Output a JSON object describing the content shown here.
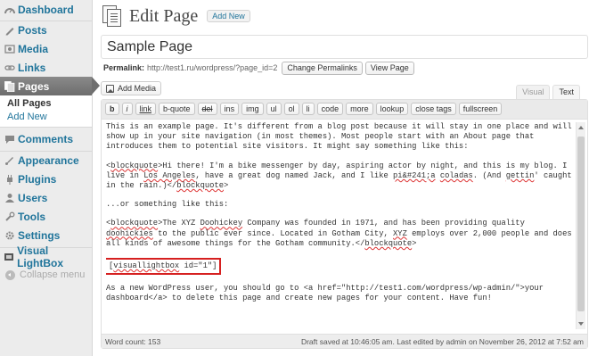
{
  "sidebar": {
    "items": [
      {
        "label": "Dashboard",
        "icon": "dashboard-icon"
      },
      {
        "label": "Posts",
        "icon": "posts-icon"
      },
      {
        "label": "Media",
        "icon": "media-icon"
      },
      {
        "label": "Links",
        "icon": "links-icon"
      },
      {
        "label": "Pages",
        "icon": "pages-icon",
        "active": true
      },
      {
        "label": "Comments",
        "icon": "comments-icon"
      },
      {
        "label": "Appearance",
        "icon": "appearance-icon"
      },
      {
        "label": "Plugins",
        "icon": "plugins-icon"
      },
      {
        "label": "Users",
        "icon": "users-icon"
      },
      {
        "label": "Tools",
        "icon": "tools-icon"
      },
      {
        "label": "Settings",
        "icon": "settings-icon"
      },
      {
        "label": "Visual LightBox",
        "icon": "lightbox-icon"
      }
    ],
    "submenu": {
      "all_pages": "All Pages",
      "add_new": "Add New"
    },
    "collapse": "Collapse menu"
  },
  "header": {
    "title": "Edit Page",
    "add_new": "Add New"
  },
  "post": {
    "title_value": "Sample Page",
    "permalink_label": "Permalink:",
    "permalink_url": "http://test1.ru/wordpress/?page_id=2",
    "change_permalinks": "Change Permalinks",
    "view_page": "View Page"
  },
  "editor": {
    "add_media": "Add Media",
    "tab_visual": "Visual",
    "tab_text": "Text",
    "quicktags": [
      "b",
      "i",
      "link",
      "b-quote",
      "del",
      "ins",
      "img",
      "ul",
      "ol",
      "li",
      "code",
      "more",
      "lookup",
      "close tags",
      "fullscreen"
    ],
    "content": {
      "p1": "This is an example page. It's different from a blog post because it will stay in one place and will show up in your site navigation (in most themes). Most people start with an About page that introduces them to potential site visitors. It might say something like this:",
      "p2a": "blockquote",
      "p2b": ">Hi there! I'm a bike messenger by day, aspiring actor by night, and this is my blog. I live in ",
      "p2c": "Los Angeles",
      "p2d": ", have a great dog named Jack, and I like ",
      "p2e": "pi&#241;a",
      "p2f": " ",
      "p2g": "coladas",
      "p2h": ". (And ",
      "p2i": "gettin",
      "p2j": "' caught in the rain.)</",
      "p2k": "blockquote",
      "p2l": ">",
      "p3": "...or something like this:",
      "p4a": "blockquote",
      "p4b": ">The XYZ ",
      "p4c": "Doohickey",
      "p4d": " Company was founded in 1971, and has been providing quality ",
      "p4e": "doohickies",
      "p4f": " to the public ever since. Located in Gotham City, ",
      "p4g": "XYZ",
      "p4h": " employs over 2,000 people and does all kinds of awesome things for the Gotham community.</",
      "p4i": "blockquote",
      "p4j": ">",
      "shortcode_a": "[",
      "shortcode_b": "visuallightbox",
      "shortcode_c": " id=\"1\"]",
      "p5": "As a new WordPress user, you should go to <a href=\"http://test1.com/wordpress/wp-admin/\">your dashboard</a> to delete this page and create new pages for your content. Have fun!"
    },
    "word_count": "Word count: 153",
    "draft_status": "Draft saved at 10:46:05 am. Last edited by admin on November 26, 2012 at 7:52 am"
  },
  "colors": {
    "link": "#21759b",
    "highlight_border": "#d62020",
    "active_menu": "#777777"
  }
}
